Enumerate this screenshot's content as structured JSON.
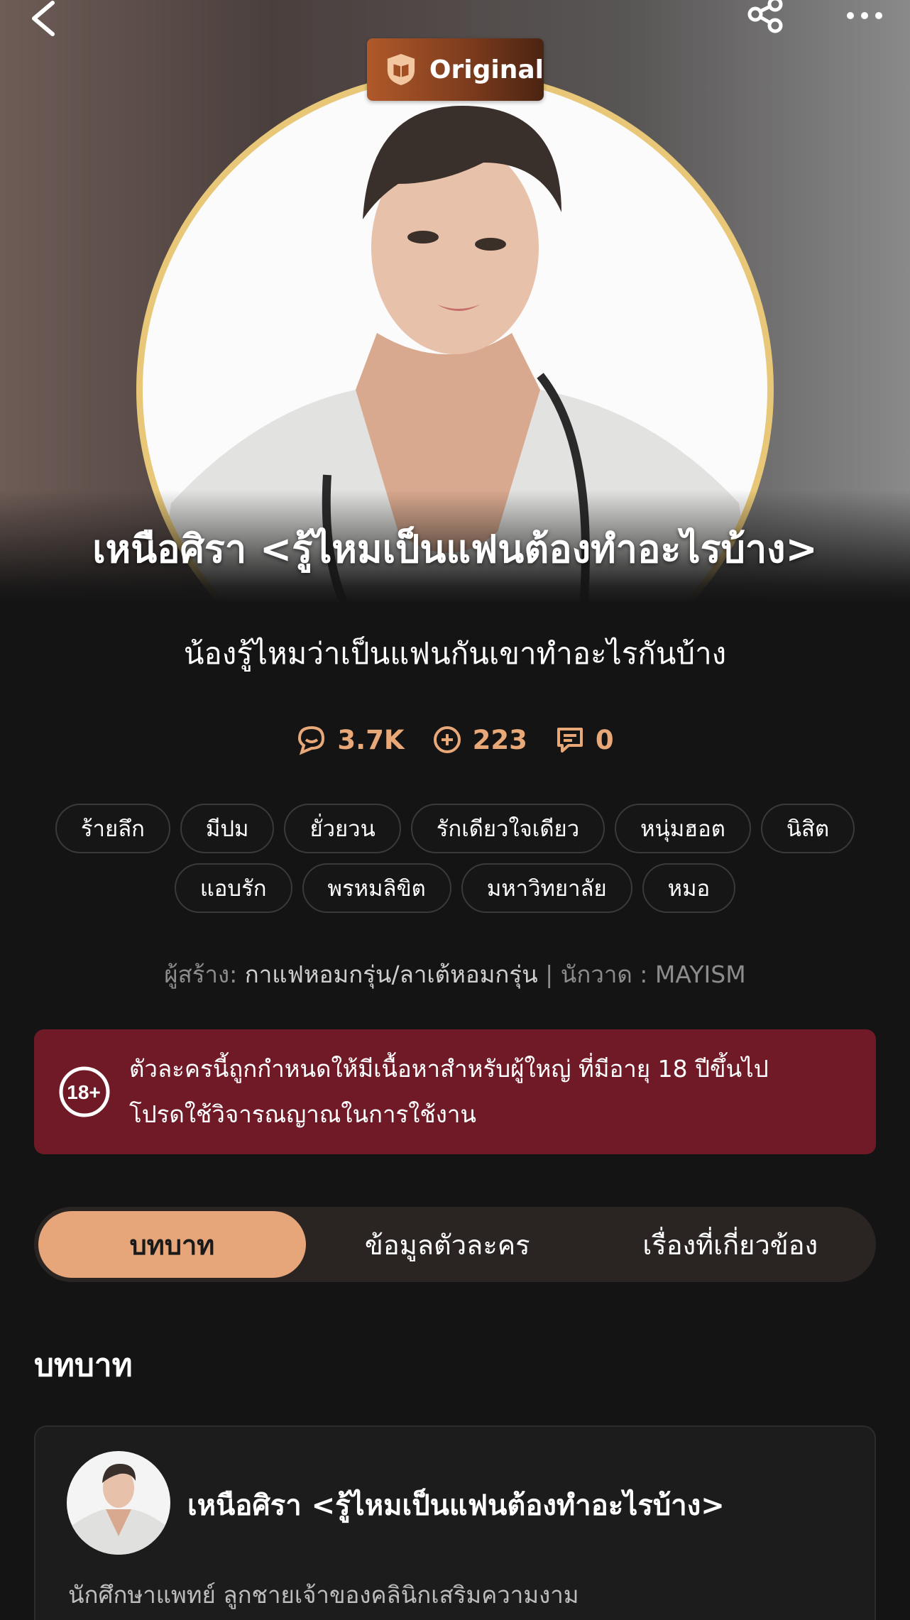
{
  "badge": {
    "label": "Original",
    "icon": "book-shield-icon"
  },
  "character": {
    "title": "เหนือศิรา <รู้ไหมเป็นแฟนต้องทำอะไรบ้าง>",
    "subtitle": "น้องรู้ไหมว่าเป็นแฟนกันเขาทำอะไรกันบ้าง"
  },
  "stats": [
    {
      "icon": "chat-bubble-icon",
      "value": "3.7K"
    },
    {
      "icon": "plus-circle-icon",
      "value": "223"
    },
    {
      "icon": "comment-icon",
      "value": "0"
    }
  ],
  "tags": [
    "ร้ายลึก",
    "มีปม",
    "ยั่วยวน",
    "รักเดียวใจเดียว",
    "หนุ่มฮอต",
    "นิสิต",
    "แอบรัก",
    "พรหมลิขิต",
    "มหาวิทยาลัย",
    "หมอ"
  ],
  "creator": {
    "label": "ผู้สร้าง:",
    "name": "กาแฟหอมกรุ่น/ลาเต้หอมกรุ่น",
    "separator": "|",
    "artist_label": "นักวาด : MAYISM"
  },
  "warning": {
    "line1": "ตัวละครนี้ถูกกำหนดให้มีเนื้อหาสำหรับผู้ใหญ่ ที่มีอายุ 18 ปีขึ้นไป",
    "line2": "โปรดใช้วิจารณญาณในการใช้งาน",
    "icon": "age-18-plus-icon",
    "color": "#6f1a26"
  },
  "tabs": [
    {
      "label": "บทบาท",
      "active": true
    },
    {
      "label": "ข้อมูลตัวละคร",
      "active": false
    },
    {
      "label": "เรื่องที่เกี่ยวข้อง",
      "active": false
    }
  ],
  "section": {
    "title": "บทบาท"
  },
  "role": {
    "name": "เหนือศิรา <รู้ไหมเป็นแฟนต้องทำอะไรบ้าง>",
    "description": "นักศึกษาแพทย์ ลูกชายเจ้าของคลินิกเสริมความงาม"
  },
  "colors": {
    "accent": "#e7a679",
    "badge": "#b0592a",
    "frame": "#e8c878",
    "background": "#141414"
  }
}
